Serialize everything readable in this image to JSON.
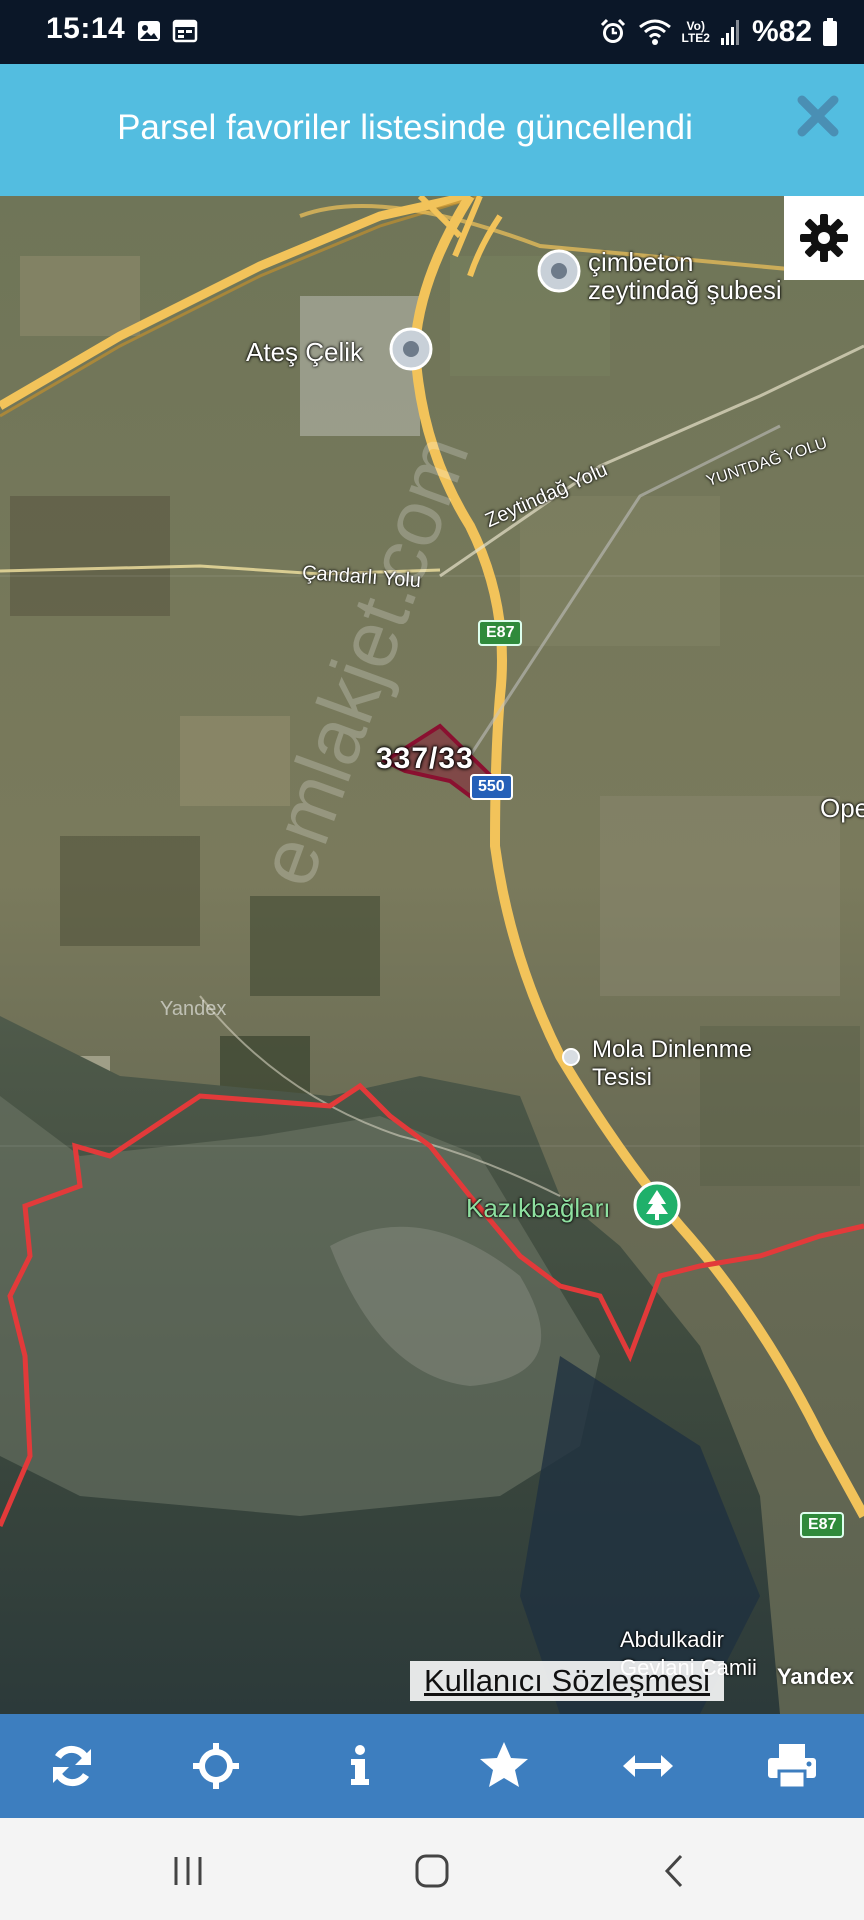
{
  "status_bar": {
    "time": "15:14",
    "network_label_top": "Vo)",
    "network_label_bottom": "LTE2",
    "battery": "%82"
  },
  "banner": {
    "message": "Parsel favoriler listesinde güncellendi",
    "close_icon": "close-icon"
  },
  "map": {
    "poi_labels": {
      "cimbeton_line1": "çimbeton",
      "cimbeton_line2": "zeytindağ şubesi",
      "ates_celik": "Ateş Çelik",
      "mola_line1": "Mola Dinlenme",
      "mola_line2": "Tesisi",
      "kazikbaglari": "Kazıkbağları",
      "abdulkadir_line1": "Abdulkadir",
      "abdulkadir_line2": "Geylani Camii",
      "ope": "Ope"
    },
    "road_labels": {
      "zeytindag_yolu": "Zeytindağ Yolu",
      "candarli_yolu": "Çandarlı Yolu",
      "yuntdag_yolu": "YUNTDAĞ YOLU",
      "e87_top": "E87",
      "e87_bottom": "E87",
      "d550": "550"
    },
    "parcel_label": "337/33",
    "watermark": "emlakjet.com",
    "yandex_small": "Yandex",
    "yandex_brand": "Yandex",
    "agreement_link": "Kullanıcı Sözleşmesi",
    "colors": {
      "boundary": "#e23a3a",
      "parcel": "#8a1030",
      "highway": "#f2c35a"
    }
  },
  "toolbar": {
    "buttons": [
      "refresh-icon",
      "locate-icon",
      "info-icon",
      "favorite-star-icon",
      "measure-arrows-icon",
      "print-icon"
    ]
  },
  "nav_bar": {
    "buttons": [
      "recent-apps-icon",
      "home-icon",
      "back-icon"
    ]
  },
  "theme": {
    "banner_bg": "#53bde0",
    "toolbar_bg": "#3d7ebf",
    "status_bg": "#0b1728"
  }
}
